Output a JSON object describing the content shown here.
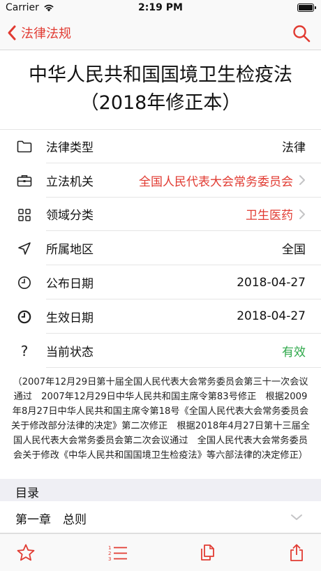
{
  "status_bar": {
    "carrier": "Carrier",
    "time": "2:19 PM"
  },
  "nav": {
    "back_label": "法律法规",
    "search_icon": "search-icon",
    "accent": "#e13b32"
  },
  "title": "中华人民共和国国境卫生检疫法（2018年修正本）",
  "info": [
    {
      "icon": "folder-icon",
      "label": "法律类型",
      "value": "法律"
    },
    {
      "icon": "briefcase-icon",
      "label": "立法机关",
      "value": "全国人民代表大会常务委员会",
      "link": true
    },
    {
      "icon": "grid-icon",
      "label": "领域分类",
      "value": "卫生医药",
      "link": true
    },
    {
      "icon": "location-arrow-icon",
      "label": "所属地区",
      "value": "全国"
    },
    {
      "icon": "clock-outline-icon",
      "label": "公布日期",
      "value": "2018-04-27"
    },
    {
      "icon": "clock-filled-icon",
      "label": "生效日期",
      "value": "2018-04-27"
    },
    {
      "icon": "question-icon",
      "label": "当前状态",
      "value": "有效",
      "status_color": "#2ea84a"
    }
  ],
  "history": "（2007年12月29日第十届全国人民代表大会常务委员会第三十一次会议通过　2007年12月29日中华人民共和国主席令第83号修正　根据2009年8月27日中华人民共和国主席令第18号《全国人民代表大会常务委员会关于修改部分法律的决定》第二次修正　根据2018年4月27日第十三届全国人民代表大会常务委员会第二次会议通过　全国人民代表大会常务委员会关于修改《中华人民共和国国境卫生检疫法》等六部法律的决定修正）",
  "toc": {
    "header": "目录",
    "items": [
      {
        "label": "第一章　总则"
      }
    ]
  },
  "tab_bar": {
    "icons": [
      "star-icon",
      "numbered-list-icon",
      "copy-icon",
      "share-icon"
    ]
  }
}
